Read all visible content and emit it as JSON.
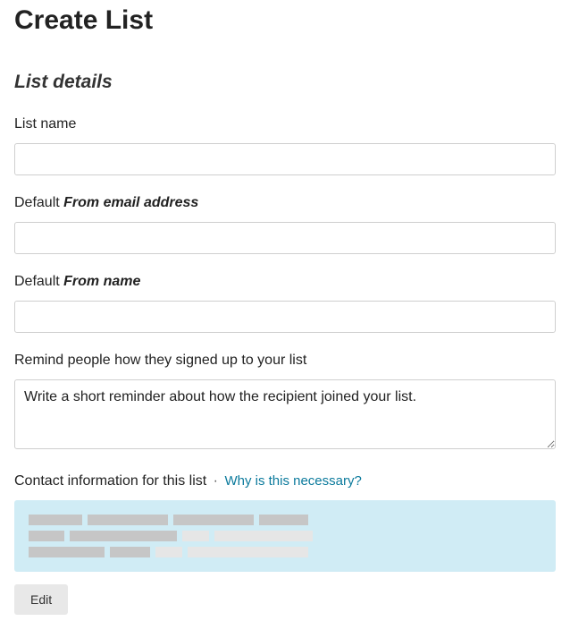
{
  "page": {
    "title": "Create List"
  },
  "section": {
    "title": "List details"
  },
  "fields": {
    "list_name": {
      "label": "List name",
      "value": ""
    },
    "from_email": {
      "label_prefix": "Default ",
      "label_italic": "From email address",
      "value": ""
    },
    "from_name": {
      "label_prefix": "Default ",
      "label_italic": "From name",
      "value": ""
    },
    "reminder": {
      "label": "Remind people how they signed up to your list",
      "placeholder": "Write a short reminder about how the recipient joined your list.",
      "value": ""
    },
    "contact": {
      "label": "Contact information for this list",
      "separator": "·",
      "help_text": "Why is this necessary?"
    }
  },
  "buttons": {
    "edit": "Edit"
  }
}
